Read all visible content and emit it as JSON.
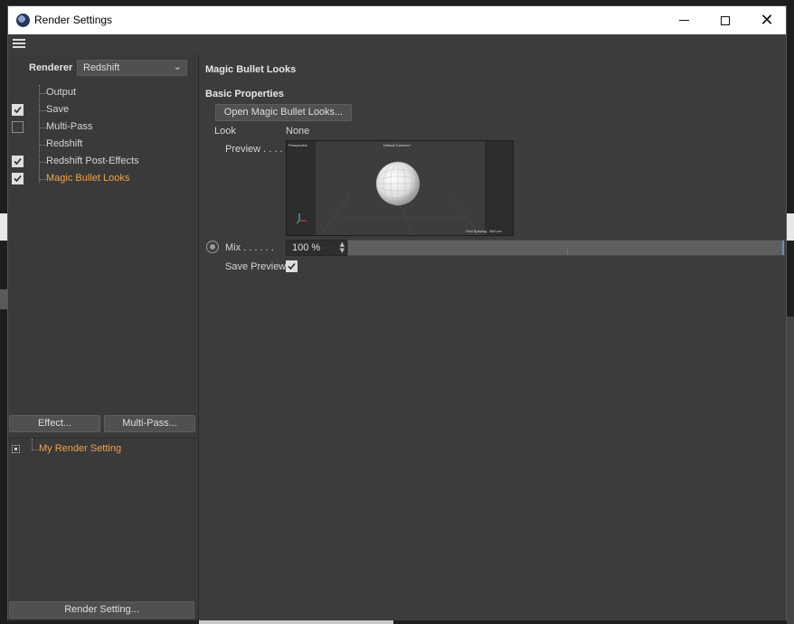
{
  "window": {
    "title": "Render Settings",
    "controls": {
      "minimize": "minimize",
      "maximize": "maximize",
      "close": "close"
    }
  },
  "left": {
    "renderer_label": "Renderer",
    "renderer_value": "Redshift",
    "tree": [
      {
        "label": "Output",
        "checkbox": null,
        "active": false
      },
      {
        "label": "Save",
        "checkbox": true,
        "active": false
      },
      {
        "label": "Multi-Pass",
        "checkbox": false,
        "active": false
      },
      {
        "label": "Redshift",
        "checkbox": null,
        "active": false
      },
      {
        "label": "Redshift Post-Effects",
        "checkbox": true,
        "active": false
      },
      {
        "label": "Magic Bullet Looks",
        "checkbox": true,
        "active": true
      }
    ],
    "effect_button": "Effect...",
    "multipass_button": "Multi-Pass...",
    "render_setting_name": "My Render Setting",
    "render_setting_button": "Render Setting..."
  },
  "right": {
    "section_title": "Magic Bullet Looks",
    "sub_title": "Basic Properties",
    "open_button": "Open Magic Bullet Looks...",
    "look_label": "Look",
    "look_value": "None",
    "preview_label": "Preview . . . .",
    "preview": {
      "perspective": "Perspective",
      "camera": "Default Camera:*",
      "grid_spacing": "Grid Spacing : 500 cm"
    },
    "mix_label": "Mix . . . . . .",
    "mix_value": "100 %",
    "mix_fraction": 1.0,
    "save_preview_label": "Save Preview",
    "save_preview_checked": true
  },
  "colors": {
    "accent_orange": "#f0a34a",
    "panel": "#3c3c3c",
    "slider_handle": "#6a8fc8"
  },
  "icons": [
    "cinema4d-app-icon",
    "hamburger-menu-icon",
    "dropdown-chevron-icon",
    "checkbox-check-icon",
    "render-setting-icon",
    "radio-icon",
    "spinner-icon"
  ]
}
